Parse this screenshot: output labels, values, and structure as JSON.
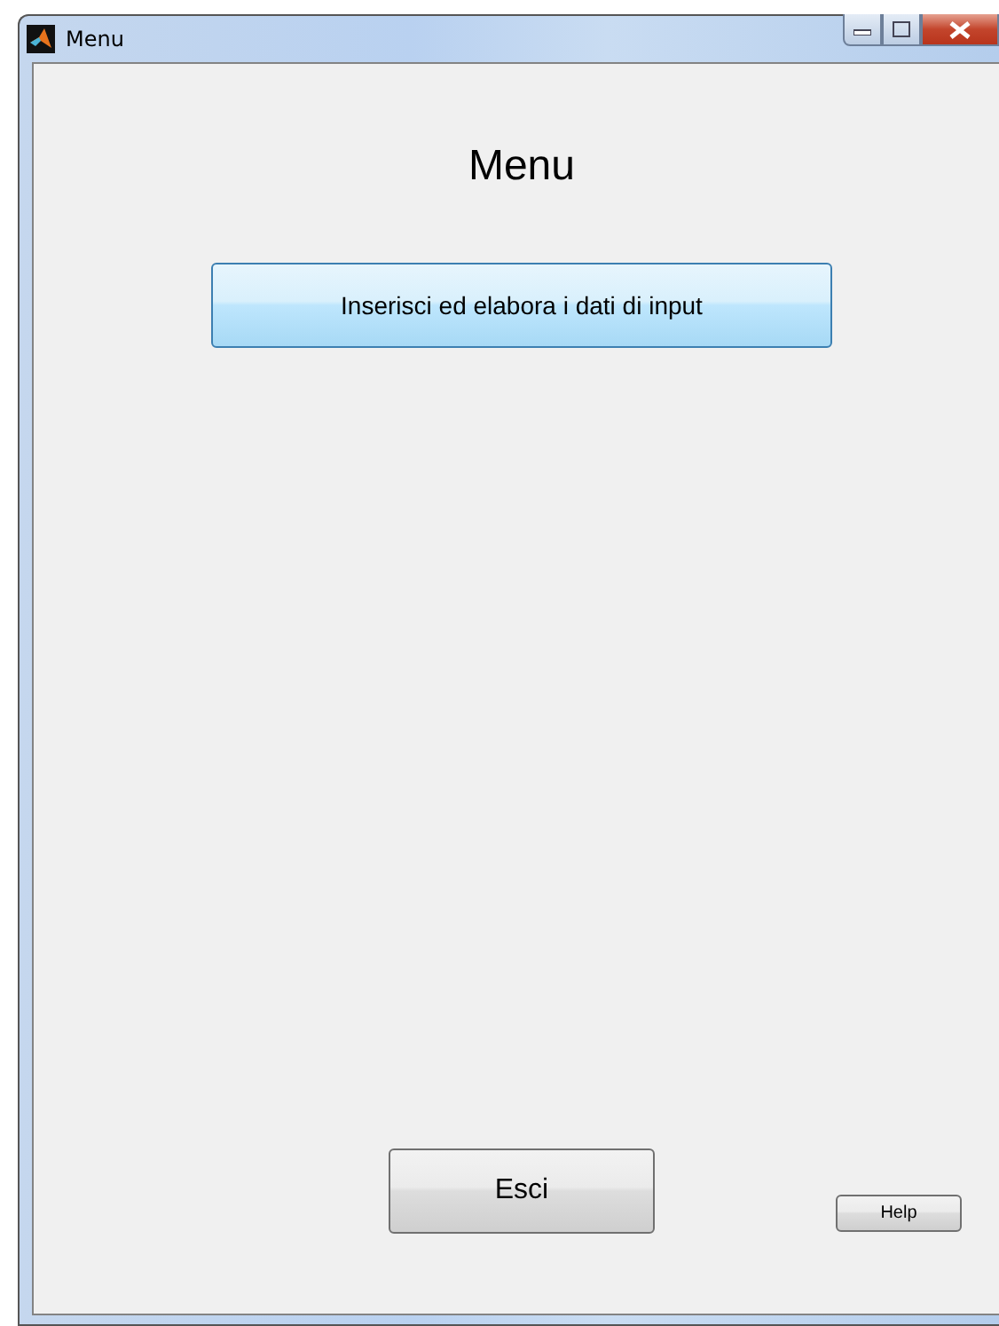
{
  "window": {
    "title": "Menu"
  },
  "heading": "Menu",
  "buttons": [
    {
      "label": "Inserisci ed elabora i dati di input"
    }
  ],
  "footer_buttons": [
    {
      "label": "Esci",
      "kind": "large"
    },
    {
      "label": "Help",
      "kind": "small"
    }
  ]
}
